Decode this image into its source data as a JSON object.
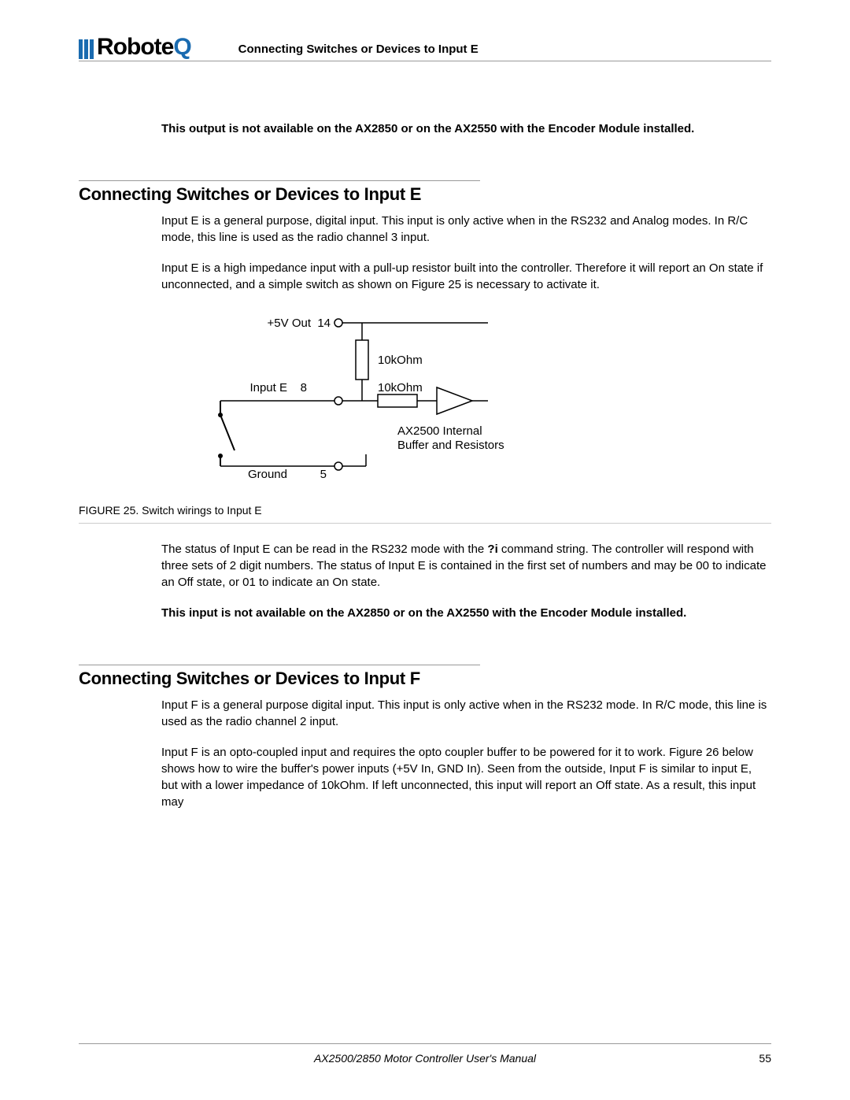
{
  "header": {
    "logo_text_main": "Robote",
    "logo_text_q": "Q",
    "section_title": "Connecting Switches or Devices to Input E"
  },
  "intro_note": "This output is not available on the AX2850 or on the AX2550 with the Encoder Module installed.",
  "section_e": {
    "heading": "Connecting Switches or Devices to Input E",
    "p1": "Input E is a general purpose, digital input. This input is only active when in the RS232 and Analog modes. In R/C mode, this line is used as the radio channel 3 input.",
    "p2": "Input E is a high impedance input with a pull-up resistor built into the controller. Therefore it will report an On state if unconnected, and a simple switch as shown on Figure 25 is necessary to activate it.",
    "figure": {
      "labels": {
        "vout": "+5V Out",
        "vout_pin": "14",
        "r1": "10kOhm",
        "input": "Input E",
        "input_pin": "8",
        "r2": "10kOhm",
        "internal1": "AX2500 Internal",
        "internal2": "Buffer and Resistors",
        "ground": "Ground",
        "ground_pin": "5"
      },
      "caption": "FIGURE 25.  Switch wirings to Input E"
    },
    "p3a": "The status of Input E can be read in the RS232 mode with the ",
    "p3cmd": "?i",
    "p3b": " command string. The controller will respond with three sets of 2 digit numbers. The status of Input E is contained in the first set of numbers and may be 00 to indicate an Off state, or 01 to indicate an On state.",
    "note": "This input is not available on the AX2850 or on the AX2550 with the Encoder Module installed."
  },
  "section_f": {
    "heading": "Connecting Switches or Devices to Input F",
    "p1": "Input F is a general purpose digital input. This input is only active when in the RS232 mode. In R/C mode, this line is used as the radio channel 2 input.",
    "p2": "Input F is an opto-coupled input and requires the opto coupler buffer to be powered for it to work. Figure 26 below shows how to wire the buffer's power inputs (+5V In, GND In). Seen from the outside, Input F is similar to input E, but with a lower impedance of 10kOhm. If left unconnected, this input will report an Off state. As a result, this input may"
  },
  "footer": {
    "title": "AX2500/2850 Motor Controller User's Manual",
    "page": "55"
  }
}
